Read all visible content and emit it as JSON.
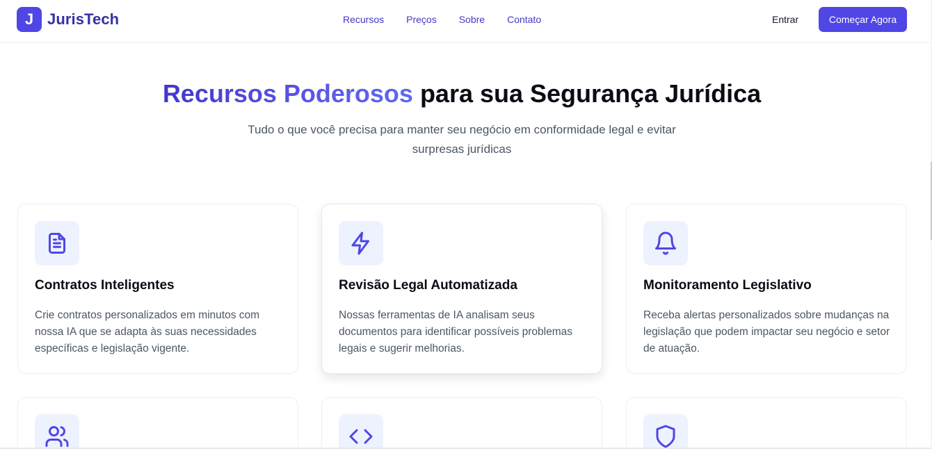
{
  "header": {
    "logo_letter": "J",
    "brand": "JurisTech",
    "nav": [
      "Recursos",
      "Preços",
      "Sobre",
      "Contato"
    ],
    "login": "Entrar",
    "cta": "Começar Agora"
  },
  "hero": {
    "title_highlight": "Recursos Poderosos",
    "title_rest": " para sua Segurança Jurídica",
    "subtitle": "Tudo o que você precisa para manter seu negócio em conformidade legal e evitar surpresas jurídicas"
  },
  "features": [
    {
      "icon": "document-icon",
      "title": "Contratos Inteligentes",
      "description": "Crie contratos personalizados em minutos com nossa IA que se adapta às suas necessidades específicas e legislação vigente."
    },
    {
      "icon": "lightning-icon",
      "title": "Revisão Legal Automatizada",
      "description": "Nossas ferramentas de IA analisam seus documentos para identificar possíveis problemas legais e sugerir melhorias."
    },
    {
      "icon": "bell-icon",
      "title": "Monitoramento Legislativo",
      "description": "Receba alertas personalizados sobre mudanças na legislação que podem impactar seu negócio e setor de atuação."
    },
    {
      "icon": "users-icon"
    },
    {
      "icon": "code-icon"
    },
    {
      "icon": "shield-icon"
    }
  ],
  "colors": {
    "primary": "#4f46e5",
    "primary_dark": "#3730a3",
    "icon_bg": "#eef2ff",
    "text_muted": "#4b5563"
  }
}
